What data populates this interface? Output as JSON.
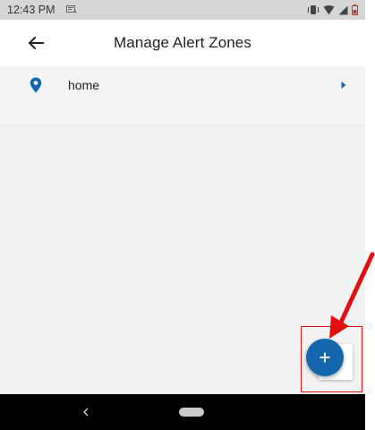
{
  "status_bar": {
    "time": "12:43 PM",
    "icons": [
      "notification-icon",
      "vibrate-icon",
      "wifi-icon",
      "signal-icon",
      "battery-low-icon"
    ]
  },
  "app_bar": {
    "title": "Manage Alert Zones",
    "back_icon": "arrow-left-icon"
  },
  "zones": [
    {
      "name": "home",
      "icon": "location-pin-icon",
      "trailing_icon": "chevron-right-icon"
    }
  ],
  "fab": {
    "icon": "plus-icon"
  },
  "colors": {
    "accent": "#1467ad",
    "annotation": "#e01010",
    "status_bar": "#d6d6d6",
    "background": "#f1f2f4",
    "nav_bar": "#000000"
  }
}
